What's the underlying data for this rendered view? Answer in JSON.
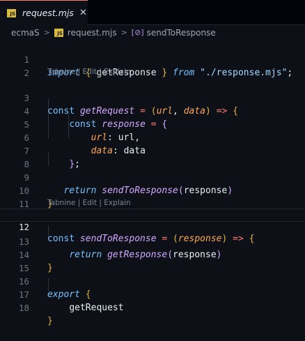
{
  "tab": {
    "badge": "JS",
    "title": "request.mjs",
    "close": "✕"
  },
  "breadcrumb": {
    "folder": "ecmaS",
    "file": "request.mjs",
    "symbol_icon": "[⊘]",
    "symbol": "sendToResponse",
    "separator": ">"
  },
  "codelens": [
    {
      "text": "Tabnine | Edit | Explain"
    },
    {
      "text": "Tabnine | Edit | Explain"
    }
  ],
  "editor": {
    "current_line": 12,
    "lines": [
      {
        "n": "1"
      },
      {
        "n": "2"
      },
      {
        "n": "3"
      },
      {
        "n": "4"
      },
      {
        "n": "5"
      },
      {
        "n": "6"
      },
      {
        "n": "7"
      },
      {
        "n": "8"
      },
      {
        "n": "9"
      },
      {
        "n": "10"
      },
      {
        "n": "11"
      },
      {
        "n": "12"
      },
      {
        "n": "13"
      },
      {
        "n": "14"
      },
      {
        "n": "15"
      },
      {
        "n": "16"
      },
      {
        "n": "17"
      },
      {
        "n": "18"
      }
    ],
    "tokens": {
      "import": "import",
      "getResponse": "getResponse",
      "from": "from",
      "path": "\"./response.mjs\"",
      "const": "const",
      "getRequest": "getRequest",
      "url": "url",
      "data": "data",
      "response": "response",
      "return": "return",
      "sendToResponse": "sendToResponse",
      "export": "export"
    }
  },
  "colors": {
    "background": "#0d1117",
    "keyword": "#79c0ff",
    "function": "#d2a8ff",
    "string": "#a5d6ff",
    "parameter": "#ffa657",
    "operator": "#ff7b72",
    "bracket": "#e3b341"
  }
}
